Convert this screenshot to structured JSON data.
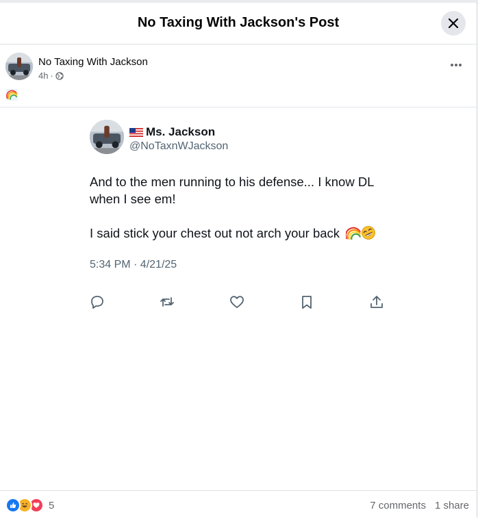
{
  "modal": {
    "title": "No Taxing With Jackson's Post"
  },
  "post": {
    "author": "No Taxing With Jackson",
    "time": "4h",
    "separator": "·",
    "caption_emoji": "rainbow-emoji",
    "privacy_icon": "globe-icon"
  },
  "tweet": {
    "flag_emoji": "us-flag-emoji",
    "name": "Ms. Jackson",
    "handle": "@NoTaxnWJackson",
    "paragraph1": "And to the men running to his defense... I know DL when I see em!",
    "paragraph2": "I said stick your chest out not arch your back",
    "trailing_emojis": [
      "rainbow-emoji",
      "rofl-emoji"
    ],
    "timestamp": "5:34 PM · 4/21/25",
    "actions": [
      "reply-icon",
      "retweet-icon",
      "like-icon",
      "bookmark-icon",
      "share-icon"
    ]
  },
  "footer": {
    "reaction_icons": [
      "like-reaction",
      "haha-reaction",
      "love-reaction"
    ],
    "reaction_count": "5",
    "comments": "7 comments",
    "shares": "1 share"
  },
  "colors": {
    "like_blue": "#1877f2",
    "love_red": "#f33e58",
    "haha_yellow": "#f7b125",
    "muted_text": "#65676b"
  }
}
